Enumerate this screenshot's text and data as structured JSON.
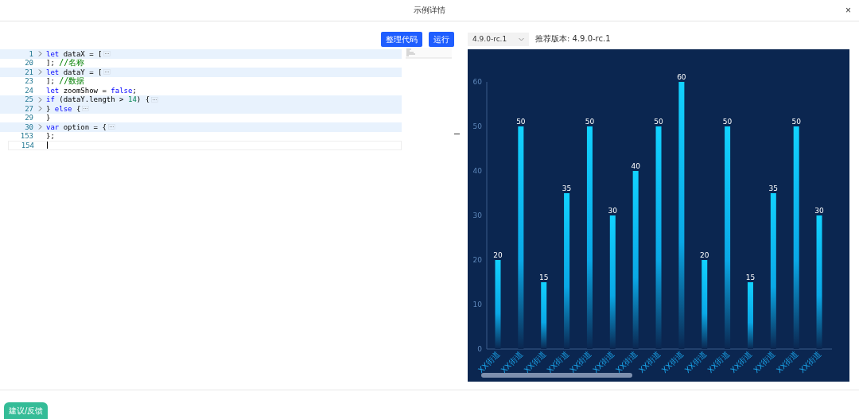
{
  "dialog": {
    "title": "示例详情",
    "close": "×"
  },
  "toolbar": {
    "buttons": [
      "整理代码",
      "运行"
    ]
  },
  "editor": {
    "lines": [
      {
        "number": "1",
        "folded": true,
        "current": false,
        "tokens": [
          {
            "kind": "keyword",
            "text": "let"
          },
          {
            "kind": "plain",
            "text": " dataX = ["
          }
        ]
      },
      {
        "number": "20",
        "folded": false,
        "current": false,
        "tokens": [
          {
            "kind": "plain",
            "text": "]; "
          },
          {
            "kind": "comment",
            "text": "//名称"
          }
        ]
      },
      {
        "number": "21",
        "folded": true,
        "current": false,
        "tokens": [
          {
            "kind": "keyword",
            "text": "let"
          },
          {
            "kind": "plain",
            "text": " dataY = ["
          }
        ]
      },
      {
        "number": "23",
        "folded": false,
        "current": false,
        "tokens": [
          {
            "kind": "plain",
            "text": "]; "
          },
          {
            "kind": "comment",
            "text": "//数据"
          }
        ]
      },
      {
        "number": "24",
        "folded": false,
        "current": false,
        "tokens": [
          {
            "kind": "keyword",
            "text": "let"
          },
          {
            "kind": "plain",
            "text": " zoomShow = "
          },
          {
            "kind": "keyword",
            "text": "false"
          },
          {
            "kind": "plain",
            "text": ";"
          }
        ]
      },
      {
        "number": "25",
        "folded": true,
        "current": false,
        "tokens": [
          {
            "kind": "keyword",
            "text": "if"
          },
          {
            "kind": "plain",
            "text": " (dataY.length > "
          },
          {
            "kind": "number",
            "text": "14"
          },
          {
            "kind": "plain",
            "text": ") {"
          }
        ]
      },
      {
        "number": "27",
        "folded": true,
        "current": false,
        "tokens": [
          {
            "kind": "plain",
            "text": "} "
          },
          {
            "kind": "keyword",
            "text": "else"
          },
          {
            "kind": "plain",
            "text": " {"
          }
        ]
      },
      {
        "number": "29",
        "folded": false,
        "current": false,
        "tokens": [
          {
            "kind": "plain",
            "text": "}"
          }
        ]
      },
      {
        "number": "30",
        "folded": true,
        "current": false,
        "tokens": [
          {
            "kind": "keyword",
            "text": "var"
          },
          {
            "kind": "plain",
            "text": " option = {"
          }
        ]
      },
      {
        "number": "153",
        "folded": false,
        "current": false,
        "tokens": [
          {
            "kind": "plain",
            "text": "};"
          }
        ]
      },
      {
        "number": "154",
        "folded": false,
        "current": true
      }
    ]
  },
  "version": {
    "value": "4.9.0-rc.1",
    "recommended": "推荐版本: 4.9.0-rc.1"
  },
  "chart": {
    "chart_data": {
      "type": "bar",
      "categories": [
        "XX街道",
        "XX街道",
        "XX街道",
        "XX街道",
        "XX街道",
        "XX街道",
        "XX街道",
        "XX街道",
        "XX街道",
        "XX街道",
        "XX街道",
        "XX街道",
        "XX街道",
        "XX街道",
        "XX街道"
      ],
      "values": [
        20,
        50,
        15,
        35,
        50,
        30,
        40,
        50,
        60,
        20,
        50,
        15,
        35,
        50,
        30
      ],
      "ylim": [
        0,
        60
      ],
      "yticks": [
        0,
        10,
        20,
        30,
        40,
        50,
        60
      ],
      "data_labels": true
    }
  },
  "feedback_button": "建议/反馈"
}
